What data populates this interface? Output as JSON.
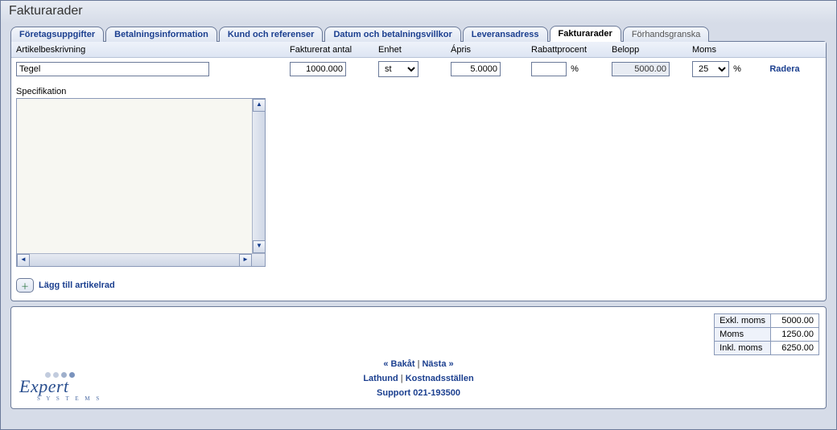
{
  "title": "Fakturarader",
  "tabs": [
    {
      "label": "Företagsuppgifter"
    },
    {
      "label": "Betalningsinformation"
    },
    {
      "label": "Kund och referenser"
    },
    {
      "label": "Datum och betalningsvillkor"
    },
    {
      "label": "Leveransadress"
    },
    {
      "label": "Fakturarader"
    },
    {
      "label": "Förhandsgranska"
    }
  ],
  "columns": {
    "description": "Artikelbeskrivning",
    "quantity": "Fakturerat antal",
    "unit": "Enhet",
    "price": "Ápris",
    "rebate": "Rabattprocent",
    "amount": "Belopp",
    "vat": "Moms"
  },
  "row": {
    "description": "Tegel",
    "quantity": "1000.000",
    "unit": "st",
    "price": "5.0000",
    "rebate": "",
    "rebate_suffix": "%",
    "amount": "5000.00",
    "vat": "25",
    "vat_suffix": "%"
  },
  "actions": {
    "delete": "Radera",
    "add_row": "Lägg till artikelrad"
  },
  "specification_label": "Specifikation",
  "totals": {
    "excl_label": "Exkl. moms",
    "excl_value": "5000.00",
    "vat_label": "Moms",
    "vat_value": "1250.00",
    "incl_label": "Inkl. moms",
    "incl_value": "6250.00"
  },
  "footer_nav": {
    "back": "« Bakåt",
    "next": "Nästa »",
    "help": "Lathund",
    "cost_centres": "Kostnadsställen",
    "support": "Support 021-193500"
  },
  "logo": {
    "brand": "Expert",
    "sub": "S Y S T E M S"
  }
}
